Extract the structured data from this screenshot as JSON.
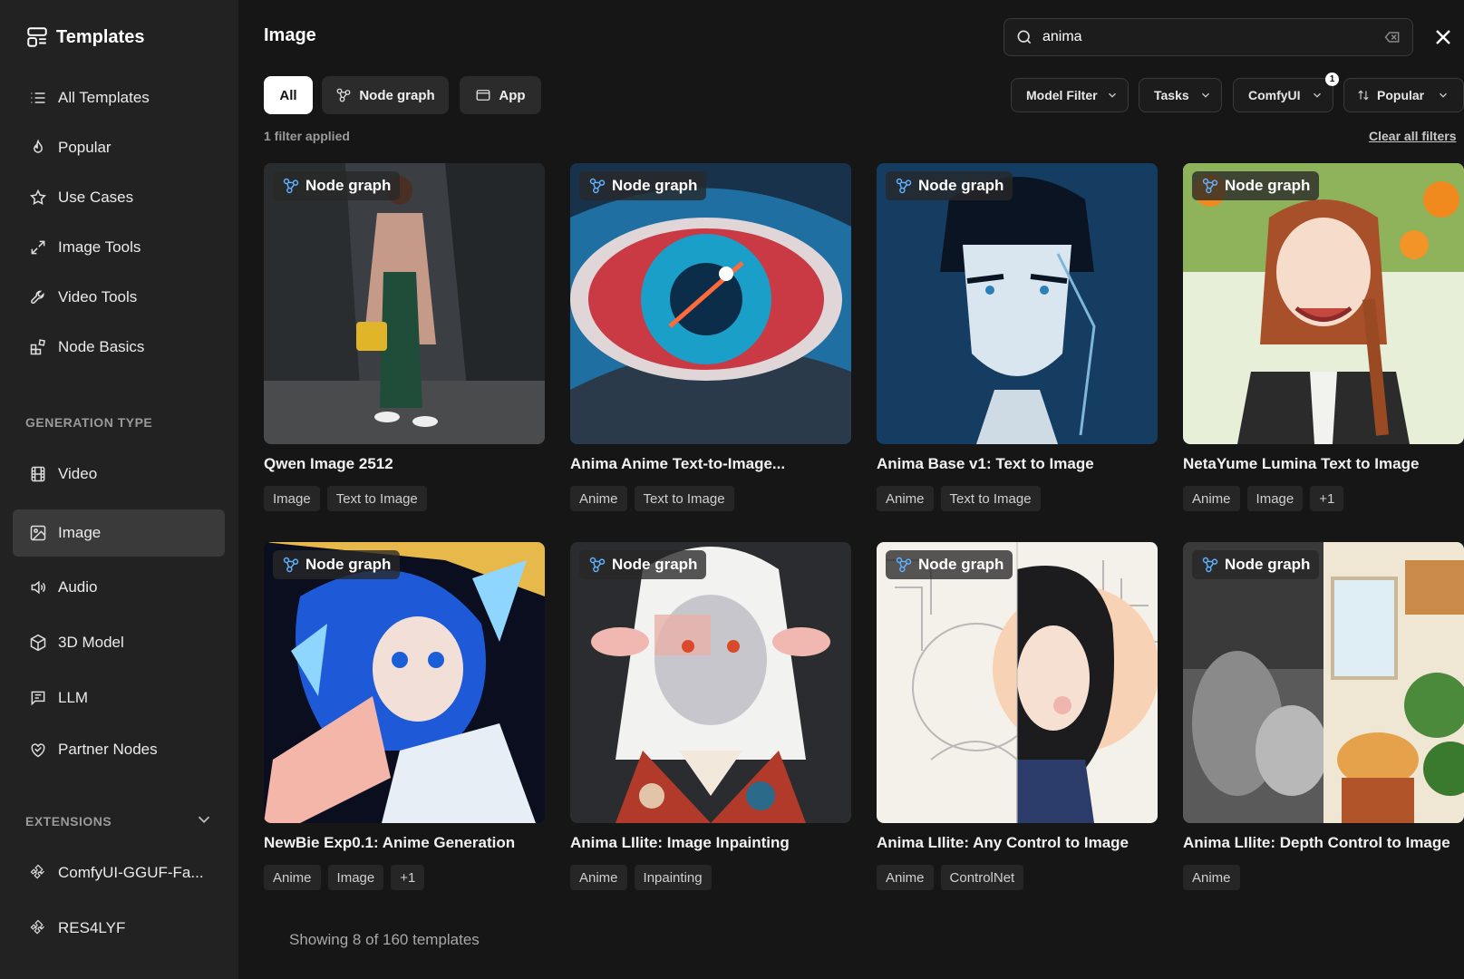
{
  "sidebar": {
    "title": "Templates",
    "nav": [
      {
        "label": "All Templates",
        "icon": "list-icon"
      },
      {
        "label": "Popular",
        "icon": "flame-icon"
      },
      {
        "label": "Use Cases",
        "icon": "star-icon"
      },
      {
        "label": "Image Tools",
        "icon": "expand-icon"
      },
      {
        "label": "Video Tools",
        "icon": "wrench-icon"
      },
      {
        "label": "Node Basics",
        "icon": "blocks-icon"
      }
    ],
    "generation_type_label": "GENERATION TYPE",
    "generation_types": [
      {
        "label": "Video",
        "icon": "film-icon"
      },
      {
        "label": "Image",
        "icon": "image-icon",
        "active": true
      },
      {
        "label": "Audio",
        "icon": "speaker-icon"
      },
      {
        "label": "3D Model",
        "icon": "cube-icon"
      },
      {
        "label": "LLM",
        "icon": "chat-icon"
      },
      {
        "label": "Partner Nodes",
        "icon": "partner-icon"
      }
    ],
    "extensions_label": "EXTENSIONS",
    "extensions": [
      {
        "label": "ComfyUI-GGUF-Fa...",
        "icon": "puzzle-icon"
      },
      {
        "label": "RES4LYF",
        "icon": "puzzle-icon"
      }
    ]
  },
  "header": {
    "title": "Image",
    "search_value": "anima"
  },
  "tabs": [
    {
      "label": "All",
      "active": true
    },
    {
      "label": "Node graph",
      "icon": "node-graph-icon"
    },
    {
      "label": "App",
      "icon": "app-window-icon"
    }
  ],
  "filters": {
    "model_filter": "Model Filter",
    "tasks": "Tasks",
    "comfyui": "ComfyUI",
    "comfyui_badge": "1",
    "sort": "Popular",
    "applied_text": "1 filter applied",
    "clear_all": "Clear all filters"
  },
  "node_graph_label": "Node graph",
  "cards": [
    {
      "title": "Qwen Image 2512",
      "tags": [
        "Image",
        "Text to Image"
      ]
    },
    {
      "title": "Anima Anime Text-to-Image...",
      "tags": [
        "Anime",
        "Text to Image"
      ]
    },
    {
      "title": "Anima Base v1: Text to Image",
      "tags": [
        "Anime",
        "Text to Image"
      ]
    },
    {
      "title": "NetaYume Lumina Text to Image",
      "tags": [
        "Anime",
        "Image",
        "+1"
      ]
    },
    {
      "title": "NewBie Exp0.1: Anime Generation",
      "tags": [
        "Anime",
        "Image",
        "+1"
      ]
    },
    {
      "title": "Anima LIlite: Image Inpainting",
      "tags": [
        "Anime",
        "Inpainting"
      ]
    },
    {
      "title": "Anima LIlite: Any Control to Image",
      "tags": [
        "Anime",
        "ControlNet"
      ]
    },
    {
      "title": "Anima LIlite: Depth Control to Image",
      "tags": [
        "Anime"
      ]
    }
  ],
  "footer": {
    "showing": "Showing 8 of 160 templates"
  },
  "colors": {
    "sidebar_bg": "#222222",
    "main_bg": "#161616",
    "active_nav": "#3a3a3a",
    "accent_icon": "#5fb0ff"
  }
}
